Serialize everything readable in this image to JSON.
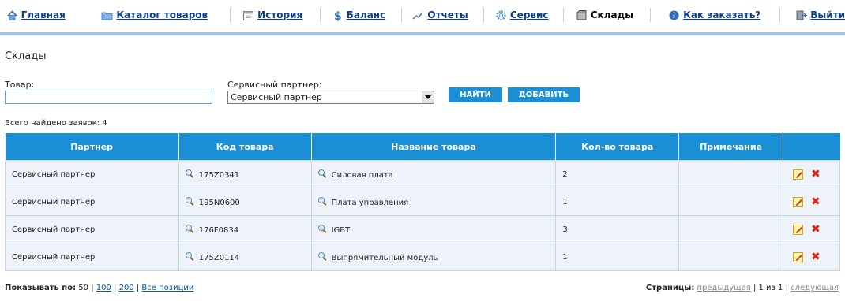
{
  "nav": {
    "items": [
      {
        "label": "Главная",
        "icon": "home-icon"
      },
      {
        "label": "Каталог товаров",
        "icon": "folder-icon"
      },
      {
        "label": "История",
        "icon": "calendar-icon"
      },
      {
        "label": "Баланс",
        "icon": "dollar-icon"
      },
      {
        "label": "Отчеты",
        "icon": "chart-icon"
      },
      {
        "label": "Сервис",
        "icon": "gear-icon"
      },
      {
        "label": "Склады",
        "icon": "box-icon"
      },
      {
        "label": "Как заказать?",
        "icon": "info-icon"
      },
      {
        "label": "Выйти",
        "icon": "exit-icon"
      }
    ],
    "active": "Склады",
    "accent": "#9cc7e0"
  },
  "page": {
    "title": "Склады"
  },
  "filter": {
    "product_label": "Товар:",
    "product_value": "",
    "partner_label": "Сервисный партнер:",
    "partner_selected": "Сервисный партнер",
    "find_button": "НАЙТИ",
    "add_button": "ДОБАВИТЬ"
  },
  "results": {
    "total_text": "Всего найдено заявок: 4"
  },
  "table": {
    "headers": [
      "Партнер",
      "Код товара",
      "Название товара",
      "Кол-во товара",
      "Примечание",
      ""
    ],
    "rows": [
      {
        "partner": "Сервисный партнер",
        "code": "175Z0341",
        "name": "Силовая плата",
        "qty": "2",
        "note": ""
      },
      {
        "partner": "Сервисный партнер",
        "code": "195N0600",
        "name": "Плата управления",
        "qty": "1",
        "note": ""
      },
      {
        "partner": "Сервисный партнер",
        "code": "176F0834",
        "name": "IGBT",
        "qty": "3",
        "note": ""
      },
      {
        "partner": "Сервисный партнер",
        "code": "175Z0114",
        "name": "Выпрямительный модуль",
        "qty": "1",
        "note": ""
      }
    ],
    "header_color": "#1a8fd6"
  },
  "pager": {
    "show_label": "Показывать по:",
    "current": "50",
    "options": [
      "100",
      "200",
      "Все позиции"
    ],
    "pages_label": "Страницы:",
    "prev": "предыдущая",
    "position": "1 из 1",
    "next": "следующая"
  }
}
